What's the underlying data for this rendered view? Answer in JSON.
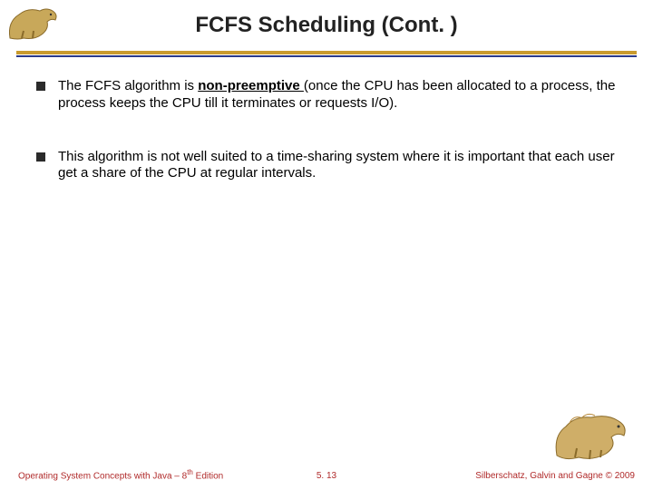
{
  "title": "FCFS Scheduling (Cont. )",
  "bullets": [
    {
      "prefix": "The FCFS algorithm is ",
      "emphasis": "non-preemptive ",
      "suffix": "(once the CPU has been allocated to a process, the process keeps the CPU till it terminates or requests I/O)."
    },
    {
      "prefix": "This algorithm is not well suited to a time-sharing system where it is important that each user get a share of the CPU at regular intervals.",
      "emphasis": "",
      "suffix": ""
    }
  ],
  "footer": {
    "left_a": "Operating System Concepts with Java – 8",
    "left_sup": "th",
    "left_b": " Edition",
    "center": "5. 13",
    "right": "Silberschatz, Galvin and Gagne © 2009"
  },
  "icons": {
    "dino_tl": "dinosaur-illustration",
    "dino_br": "dinosaur-illustration"
  }
}
